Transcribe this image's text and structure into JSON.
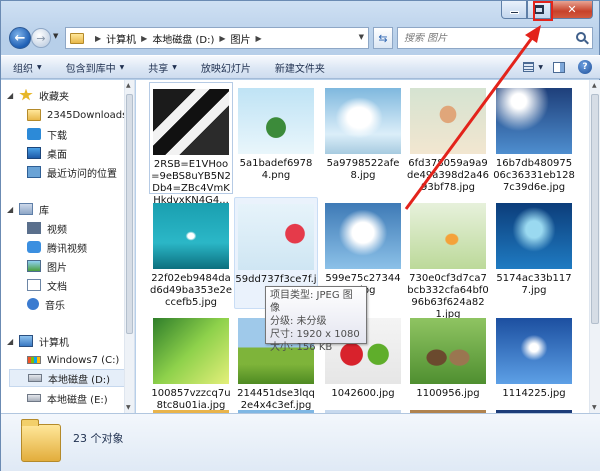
{
  "window": {
    "caption": {
      "minimize": "",
      "maximize": "",
      "close": "✕"
    }
  },
  "address": {
    "crumbs": [
      "计算机",
      "本地磁盘 (D:)",
      "图片"
    ],
    "search_placeholder": "搜索 图片"
  },
  "toolbar": {
    "items": [
      {
        "label": "组织",
        "caret": true
      },
      {
        "label": "包含到库中",
        "caret": true
      },
      {
        "label": "共享",
        "caret": true
      },
      {
        "label": "放映幻灯片",
        "caret": false
      },
      {
        "label": "新建文件夹",
        "caret": false
      }
    ]
  },
  "nav": {
    "favorites": "收藏夹",
    "fav_items": [
      "2345Downloads",
      "下载",
      "桌面",
      "最近访问的位置"
    ],
    "libraries": "库",
    "lib_items": [
      "视频",
      "腾讯视频",
      "图片",
      "文档",
      "音乐"
    ],
    "computer": "计算机",
    "pc_items": [
      "Windows7 (C:)",
      "本地磁盘 (D:)",
      "本地磁盘 (E:)"
    ]
  },
  "files": [
    {
      "name": "2RSB=E1VHoo=9eBS8uYB5N2Db4=ZBc4VmKHkdvxKN4G4...",
      "thumb": "football"
    },
    {
      "name": "5a1badef69784.png",
      "thumb": "island"
    },
    {
      "name": "5a9798522afe8.jpg",
      "thumb": "bride"
    },
    {
      "name": "6fd378059a9a9de49a398d2a4693bf78.jpg",
      "thumb": "girl"
    },
    {
      "name": "16b7db48097506c36331eb1287c39d6e.jpg",
      "thumb": "sunray"
    },
    {
      "name": "22f02eb9484dad6d49ba353e2eccefb5.jpg",
      "thumb": "plant"
    },
    {
      "name": "59dd737f3ce7f.jpg",
      "thumb": "fish"
    },
    {
      "name": "599e75c273443.jpg",
      "thumb": "sea"
    },
    {
      "name": "730e0cf3d7ca7bcb332cfa64bf096b63f624a821.jpg",
      "thumb": "bulb"
    },
    {
      "name": "5174ac33b1177.jpg",
      "thumb": "ocean"
    },
    {
      "name": "100857vzzcq7u8tc8u01ia.jpg",
      "thumb": "green"
    },
    {
      "name": "214451dse3lqq2e4x4c3ef.jpg",
      "thumb": "field"
    },
    {
      "name": "1042600.jpg",
      "thumb": "fruit"
    },
    {
      "name": "1100956.jpg",
      "thumb": "rabbits"
    },
    {
      "name": "1114225.jpg",
      "thumb": "blue"
    }
  ],
  "tooltip": {
    "lines": [
      "项目类型: JPEG 图像",
      "分级: 未分级",
      "尺寸: 1920 x 1080",
      "大小: 156 KB"
    ]
  },
  "details": {
    "count": "23 个对象"
  },
  "colors": {
    "annotation": "#e3231b",
    "selection": "#e5eef9"
  }
}
